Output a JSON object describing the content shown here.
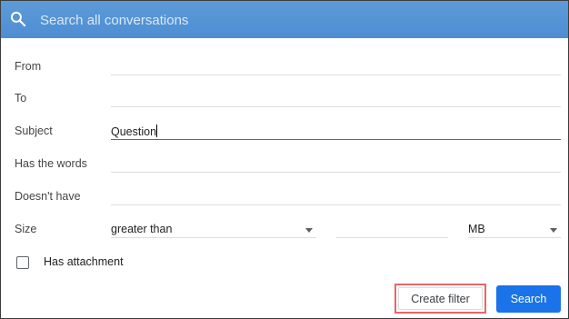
{
  "search": {
    "placeholder": "Search all conversations",
    "value": "",
    "icon": "search-icon"
  },
  "form": {
    "from": {
      "label": "From",
      "value": ""
    },
    "to": {
      "label": "To",
      "value": ""
    },
    "subject": {
      "label": "Subject",
      "value": "Question"
    },
    "has_words": {
      "label": "Has the words",
      "value": ""
    },
    "doesnt_have": {
      "label": "Doesn't have",
      "value": ""
    },
    "size": {
      "label": "Size",
      "operator": "greater than",
      "value": "",
      "unit": "MB"
    },
    "has_attachment": {
      "label": "Has attachment",
      "checked": false
    }
  },
  "actions": {
    "create_filter_label": "Create filter",
    "search_label": "Search"
  },
  "colors": {
    "header_blue": "#5d9ad8",
    "primary_button": "#1a73e8",
    "highlight_border": "#e8676a",
    "active_underline": "#1a73e8"
  }
}
